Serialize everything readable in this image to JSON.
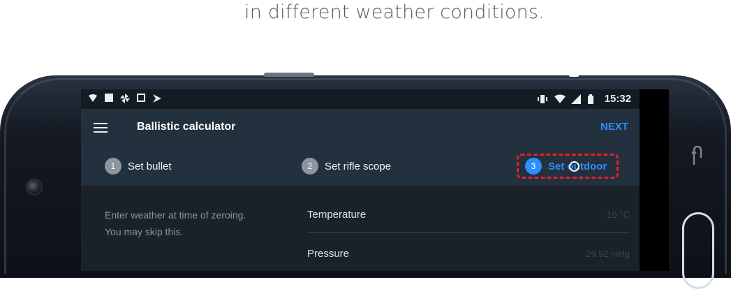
{
  "caption": {
    "text": "in different weather conditions."
  },
  "status_bar": {
    "left_icons": [
      "wifi-question-icon",
      "image-icon",
      "pinwheel-icon",
      "download-icon",
      "play-store-icon"
    ],
    "right_icons": [
      "vibrate-icon",
      "wifi-icon",
      "signal-icon",
      "battery-icon"
    ],
    "time": "15:32"
  },
  "app_bar": {
    "title": "Ballistic calculator",
    "next_label": "NEXT"
  },
  "steps": [
    {
      "number": "1",
      "label": "Set bullet"
    },
    {
      "number": "2",
      "label": "Set rifle scope"
    },
    {
      "number": "3",
      "label": "Set outdoor"
    }
  ],
  "hint": {
    "line1": "Enter weather at time of zeroing.",
    "line2": "You  may skip this."
  },
  "fields": [
    {
      "label": "Temperature",
      "value": "16 °C"
    },
    {
      "label": "Pressure",
      "value": "29.92 inHg"
    }
  ],
  "colors": {
    "accent": "#2e8dff",
    "highlight": "#e0222f",
    "appbar": "#23303d",
    "content_bg": "#1a2129"
  }
}
